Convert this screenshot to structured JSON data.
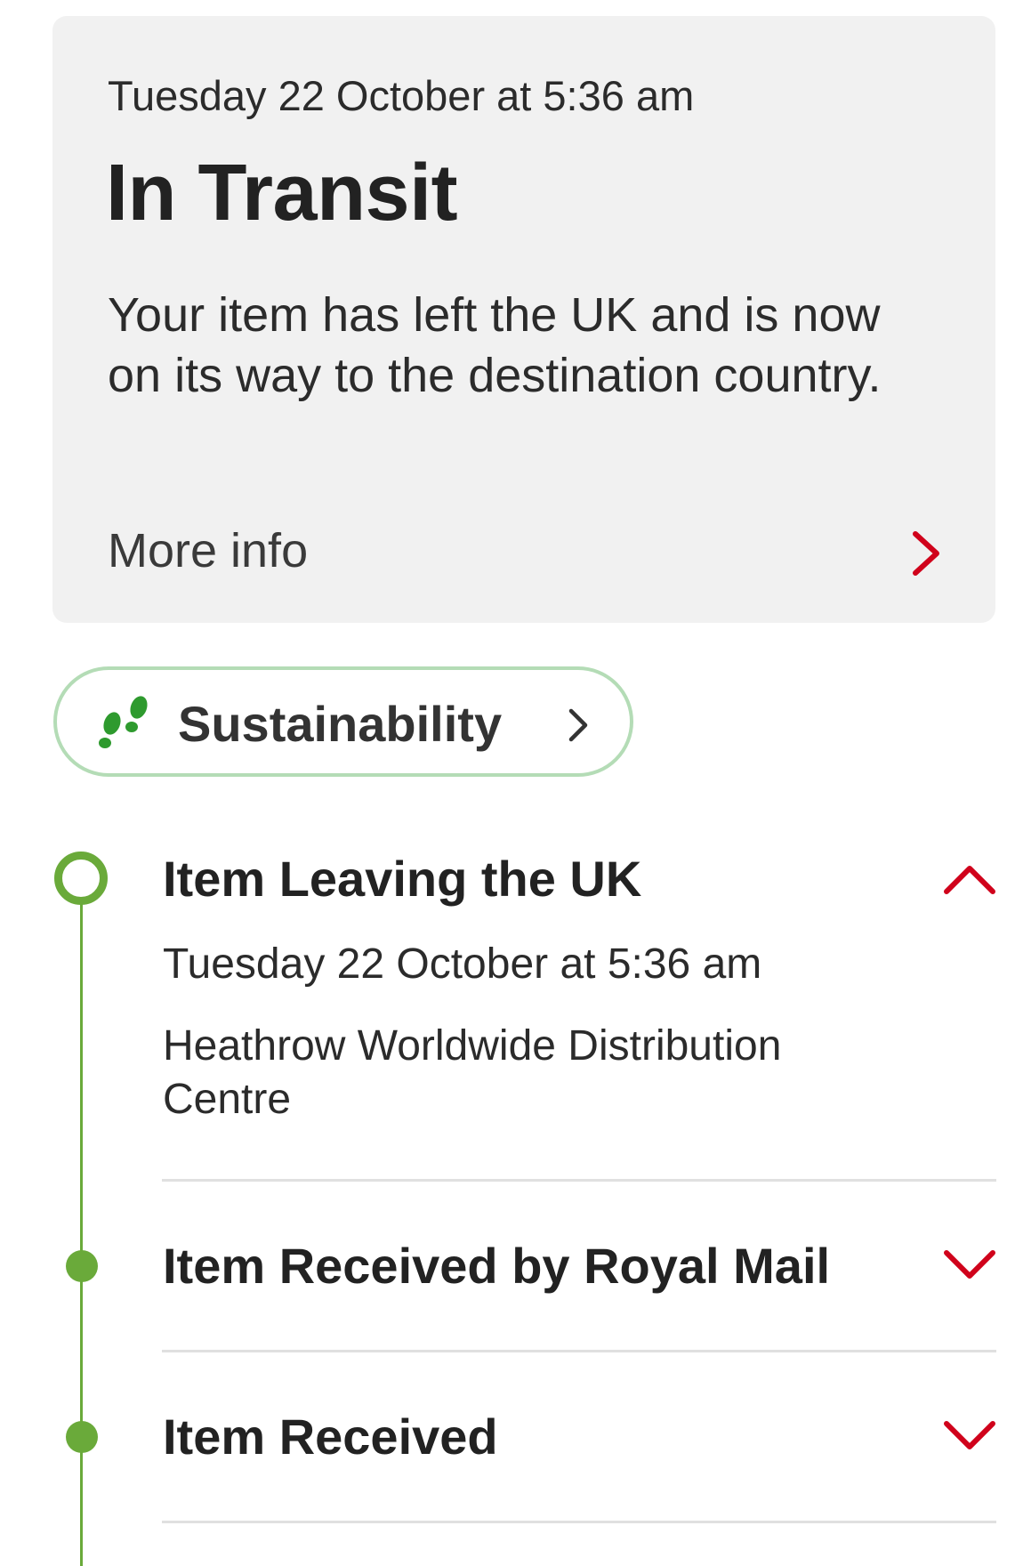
{
  "status_card": {
    "date": "Tuesday 22 October at 5:36 am",
    "title": "In Transit",
    "description": "Your item has left the UK and is now on its way to the destination country.",
    "more_info_label": "More info"
  },
  "sustainability": {
    "label": "Sustainability",
    "icon": "footprints-icon"
  },
  "timeline": {
    "events": [
      {
        "title": "Item Leaving the UK",
        "date": "Tuesday 22 October at 5:36 am",
        "location": "Heathrow Worldwide Distribution Centre",
        "expanded": true
      },
      {
        "title": "Item Received by Royal Mail",
        "expanded": false
      },
      {
        "title": "Item Received",
        "expanded": false
      }
    ]
  },
  "colors": {
    "accent_red": "#d0021b",
    "timeline_green": "#6aaa3a",
    "card_background": "#f1f1f1",
    "pill_border": "#b4dcb6"
  }
}
